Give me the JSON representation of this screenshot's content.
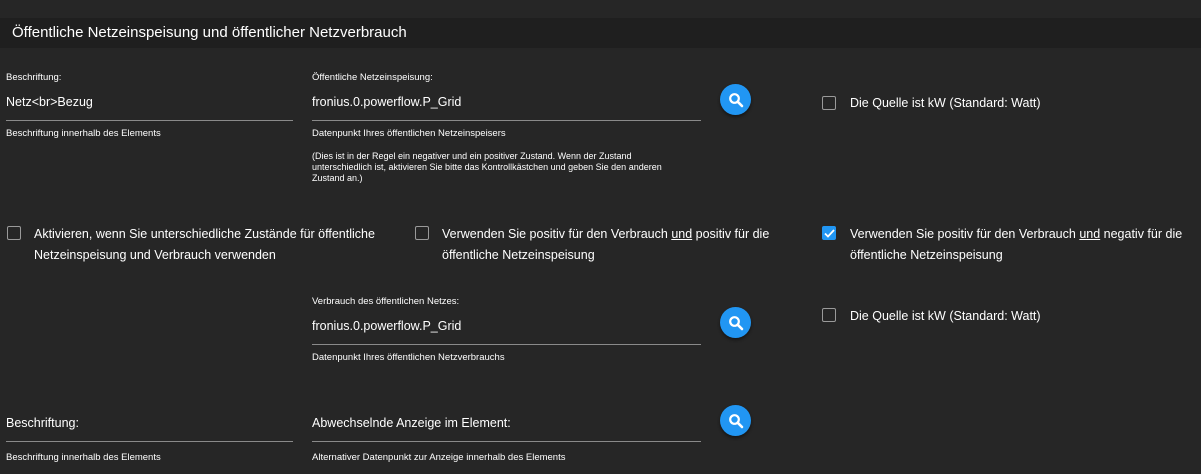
{
  "section": {
    "title": "Öffentliche Netzeinspeisung und öffentlicher Netzverbrauch"
  },
  "row1": {
    "caption_label": "Beschriftung:",
    "caption_value": "Netz<br>Bezug",
    "caption_help": "Beschriftung innerhalb des Elements",
    "feed_label": "Öffentliche Netzeinspeisung:",
    "feed_value": "fronius.0.powerflow.P_Grid",
    "feed_help": "Datenpunkt Ihres öffentlichen Netzeinspeisers",
    "feed_note": "(Dies ist in der Regel ein negativer und ein positiver Zustand. Wenn der Zustand unterschiedlich ist, aktivieren Sie bitte das Kontrollkästchen und geben Sie den anderen Zustand an.)",
    "kw_label": "Die Quelle ist kW (Standard: Watt)"
  },
  "options": {
    "different_states": "Aktivieren, wenn Sie unterschiedliche Zustände für öffentliche Netzeinspeisung und Verbrauch verwenden",
    "pos_pos_a": "Verwenden Sie positiv für den Verbrauch ",
    "pos_pos_und": "und",
    "pos_pos_b": " positiv für die öffentliche Netzeinspeisung",
    "pos_neg_a": "Verwenden Sie positiv für den Verbrauch ",
    "pos_neg_und": "und",
    "pos_neg_b": " negativ für die öffentliche Netzeinspeisung"
  },
  "row2": {
    "consumption_label": "Verbrauch des öffentlichen Netzes:",
    "consumption_value": "fronius.0.powerflow.P_Grid",
    "consumption_help": "Datenpunkt Ihres öffentlichen Netzverbrauchs",
    "kw_label": "Die Quelle ist kW (Standard: Watt)"
  },
  "row3": {
    "caption_placeholder": "Beschriftung:",
    "caption_help": "Beschriftung innerhalb des Elements",
    "alt_placeholder": "Abwechselnde Anzeige im Element:",
    "alt_help": "Alternativer Datenpunkt zur Anzeige innerhalb des Elements"
  },
  "checkbox_states": {
    "row1_kw": false,
    "different_states": false,
    "pos_pos": false,
    "pos_neg": true,
    "row2_kw": false
  },
  "colors": {
    "background": "#262626",
    "section_bar": "#1f1f1f",
    "accent": "#2196f3",
    "underline": "#8a8a8a"
  },
  "icons": {
    "search": "search-icon",
    "check": "check-icon"
  }
}
